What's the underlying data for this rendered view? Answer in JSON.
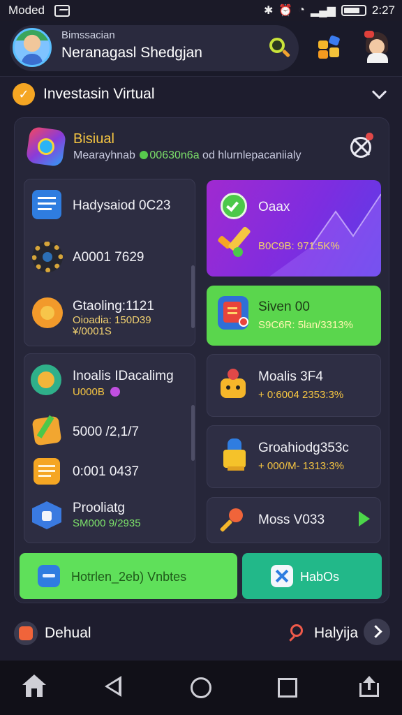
{
  "status_bar": {
    "carrier": "Moded",
    "time": "2:27"
  },
  "header": {
    "subtitle": "Bimssacian",
    "username": "Neranagasl Shedgjan"
  },
  "section": {
    "title": "Investasin Virtual"
  },
  "card": {
    "title": "Bisiual",
    "subtitle_prefix": "Mearayhnab",
    "subtitle_highlight": "00630n6a",
    "subtitle_suffix": "od hlurnlepacaniialy"
  },
  "left_panel_1": {
    "rows": [
      {
        "label": "Hadysaiod 0C23"
      },
      {
        "label": "A0001 7629"
      },
      {
        "label": "Gtaoling:1121",
        "sub1": "Oioadia: 150D39",
        "sub2": "¥/0001S"
      }
    ]
  },
  "left_panel_2": {
    "rows": [
      {
        "label": "Inoalis IDacalimg",
        "sub": "U000B"
      },
      {
        "label": "5000 /2,1/7"
      },
      {
        "label": "0:001 0437"
      },
      {
        "label": "Prooliatg",
        "sub": "SM000 9/2935"
      }
    ]
  },
  "right_cards": {
    "purple": {
      "title": "Oaax",
      "value": "B0C9B: 971:5K%"
    },
    "green": {
      "title": "Siven 00",
      "value": "S9C6R: 5lan/3313%"
    },
    "item1": {
      "title": "Moalis 3F4",
      "value": "+ 0:6004 2353:3%"
    },
    "item2": {
      "title": "Groahiodg353c",
      "value": "+ 000/M- 1313:3%"
    },
    "item3": {
      "title": "Moss V033"
    }
  },
  "buttons": {
    "primary": "Hotrlen_2eb) Vnbtes",
    "secondary": "HabOs"
  },
  "footer": {
    "left_label": "Dehual",
    "right_label": "Halyija"
  },
  "colors": {
    "background": "#1e1d2e",
    "accent_green": "#5fe05a",
    "accent_teal": "#22b889",
    "accent_purple": "#8a2ed8",
    "accent_yellow": "#f5c542"
  }
}
